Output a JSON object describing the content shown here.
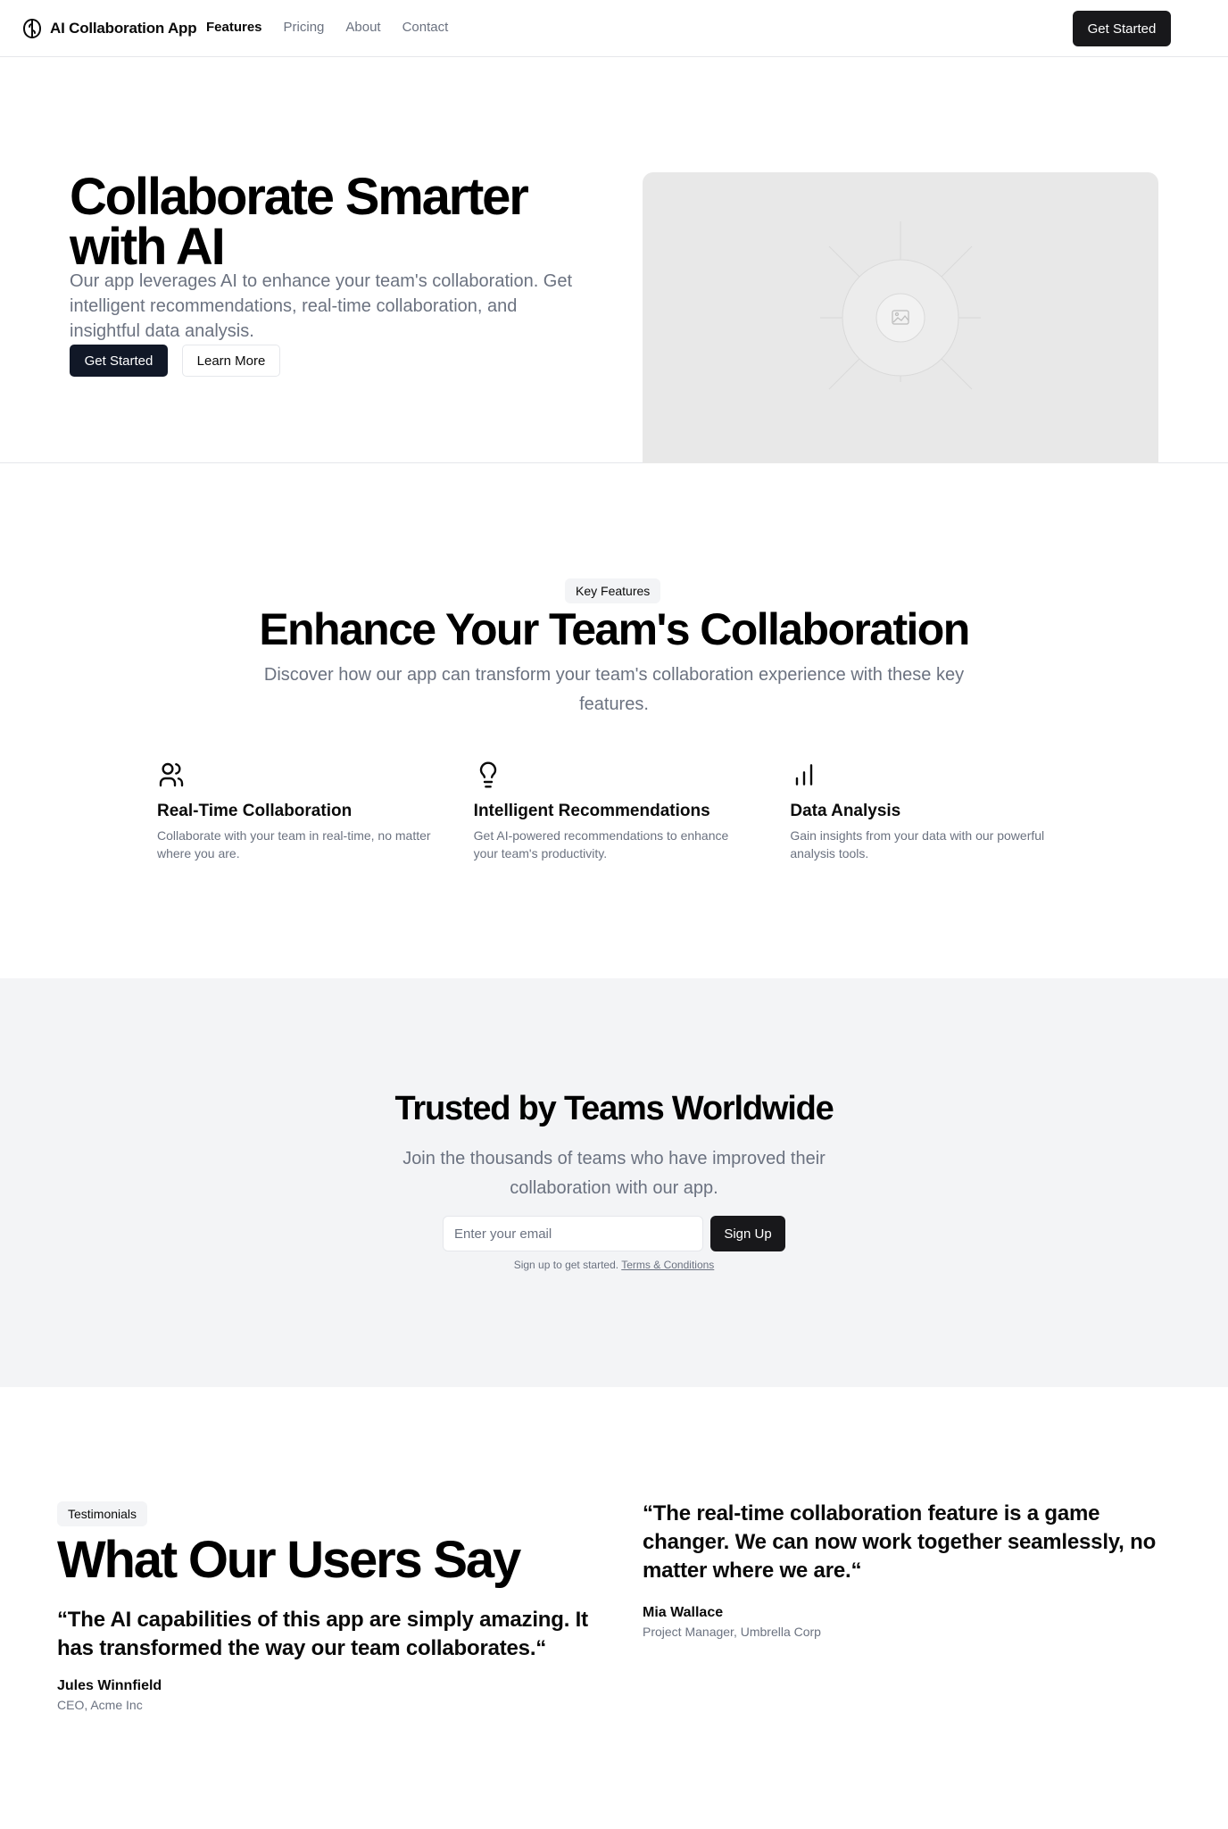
{
  "header": {
    "brand": "AI Collaboration App",
    "nav": [
      {
        "label": "Features",
        "active": true
      },
      {
        "label": "Pricing",
        "active": false
      },
      {
        "label": "About",
        "active": false
      },
      {
        "label": "Contact",
        "active": false
      }
    ],
    "cta_label": "Get Started"
  },
  "hero": {
    "title": "Collaborate Smarter with AI",
    "description": "Our app leverages AI to enhance your team's collaboration. Get intelligent recommendations, real-time collaboration, and insightful data analysis.",
    "primary_button": "Get Started",
    "secondary_button": "Learn More",
    "image_icon": "image-placeholder-icon"
  },
  "features": {
    "badge": "Key Features",
    "title": "Enhance Your Team's Collaboration",
    "description": "Discover how our app can transform your team's collaboration experience with these key features.",
    "items": [
      {
        "icon": "users-icon",
        "title": "Real-Time Collaboration",
        "description": "Collaborate with your team in real-time, no matter where you are."
      },
      {
        "icon": "lightbulb-icon",
        "title": "Intelligent Recommendations",
        "description": "Get AI-powered recommendations to enhance your team's productivity."
      },
      {
        "icon": "bar-chart-icon",
        "title": "Data Analysis",
        "description": "Gain insights from your data with our powerful analysis tools."
      }
    ]
  },
  "trusted": {
    "title": "Trusted by Teams Worldwide",
    "description": "Join the thousands of teams who have improved their collaboration with our app.",
    "email_placeholder": "Enter your email",
    "signup_button": "Sign Up",
    "note": "Sign up to get started.",
    "terms_link": "Terms & Conditions"
  },
  "testimonials": {
    "badge": "Testimonials",
    "title": "What Our Users Say",
    "items": [
      {
        "quote": "“The AI capabilities of this app are simply amazing. It has transformed the way our team collaborates.“",
        "name": "Jules Winnfield",
        "role": "CEO, Acme Inc"
      },
      {
        "quote": "“The real-time collaboration feature is a game changer. We can now work together seamlessly, no matter where we are.“",
        "name": "Mia Wallace",
        "role": "Project Manager, Umbrella Corp"
      }
    ]
  },
  "colors": {
    "primary": "#18181b",
    "muted_text": "#6b7280",
    "section_bg": "#f3f4f6",
    "placeholder_bg": "#e8e8e8"
  }
}
